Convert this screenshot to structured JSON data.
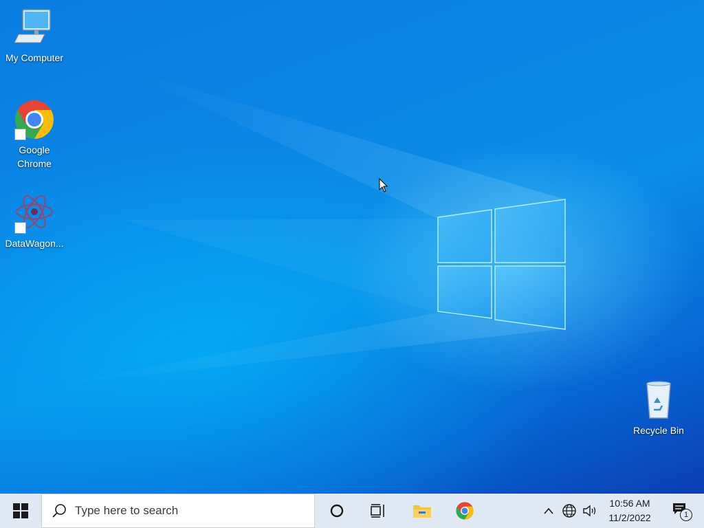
{
  "desktop": {
    "icons": [
      {
        "label": "My Computer",
        "icon": "computer-icon"
      },
      {
        "label": "Google\nChrome",
        "icon": "chrome-icon"
      },
      {
        "label": "DataWagon...",
        "icon": "datawagon-icon"
      },
      {
        "label": "Recycle Bin",
        "icon": "recycle-bin-icon"
      }
    ]
  },
  "taskbar": {
    "search_placeholder": "Type here to search",
    "pinned": [
      {
        "name": "cortana",
        "icon": "cortana-circle-icon"
      },
      {
        "name": "task-view",
        "icon": "task-view-icon"
      },
      {
        "name": "file-explorer",
        "icon": "folder-icon"
      },
      {
        "name": "google-chrome",
        "icon": "chrome-icon"
      }
    ],
    "tray": {
      "time": "10:56 AM",
      "date": "11/2/2022",
      "notification_count": "1"
    }
  },
  "colors": {
    "taskbar_bg": "#dfe8f3",
    "desktop_blue": "#0a86e6",
    "logo_light": "#8fe3ff"
  }
}
